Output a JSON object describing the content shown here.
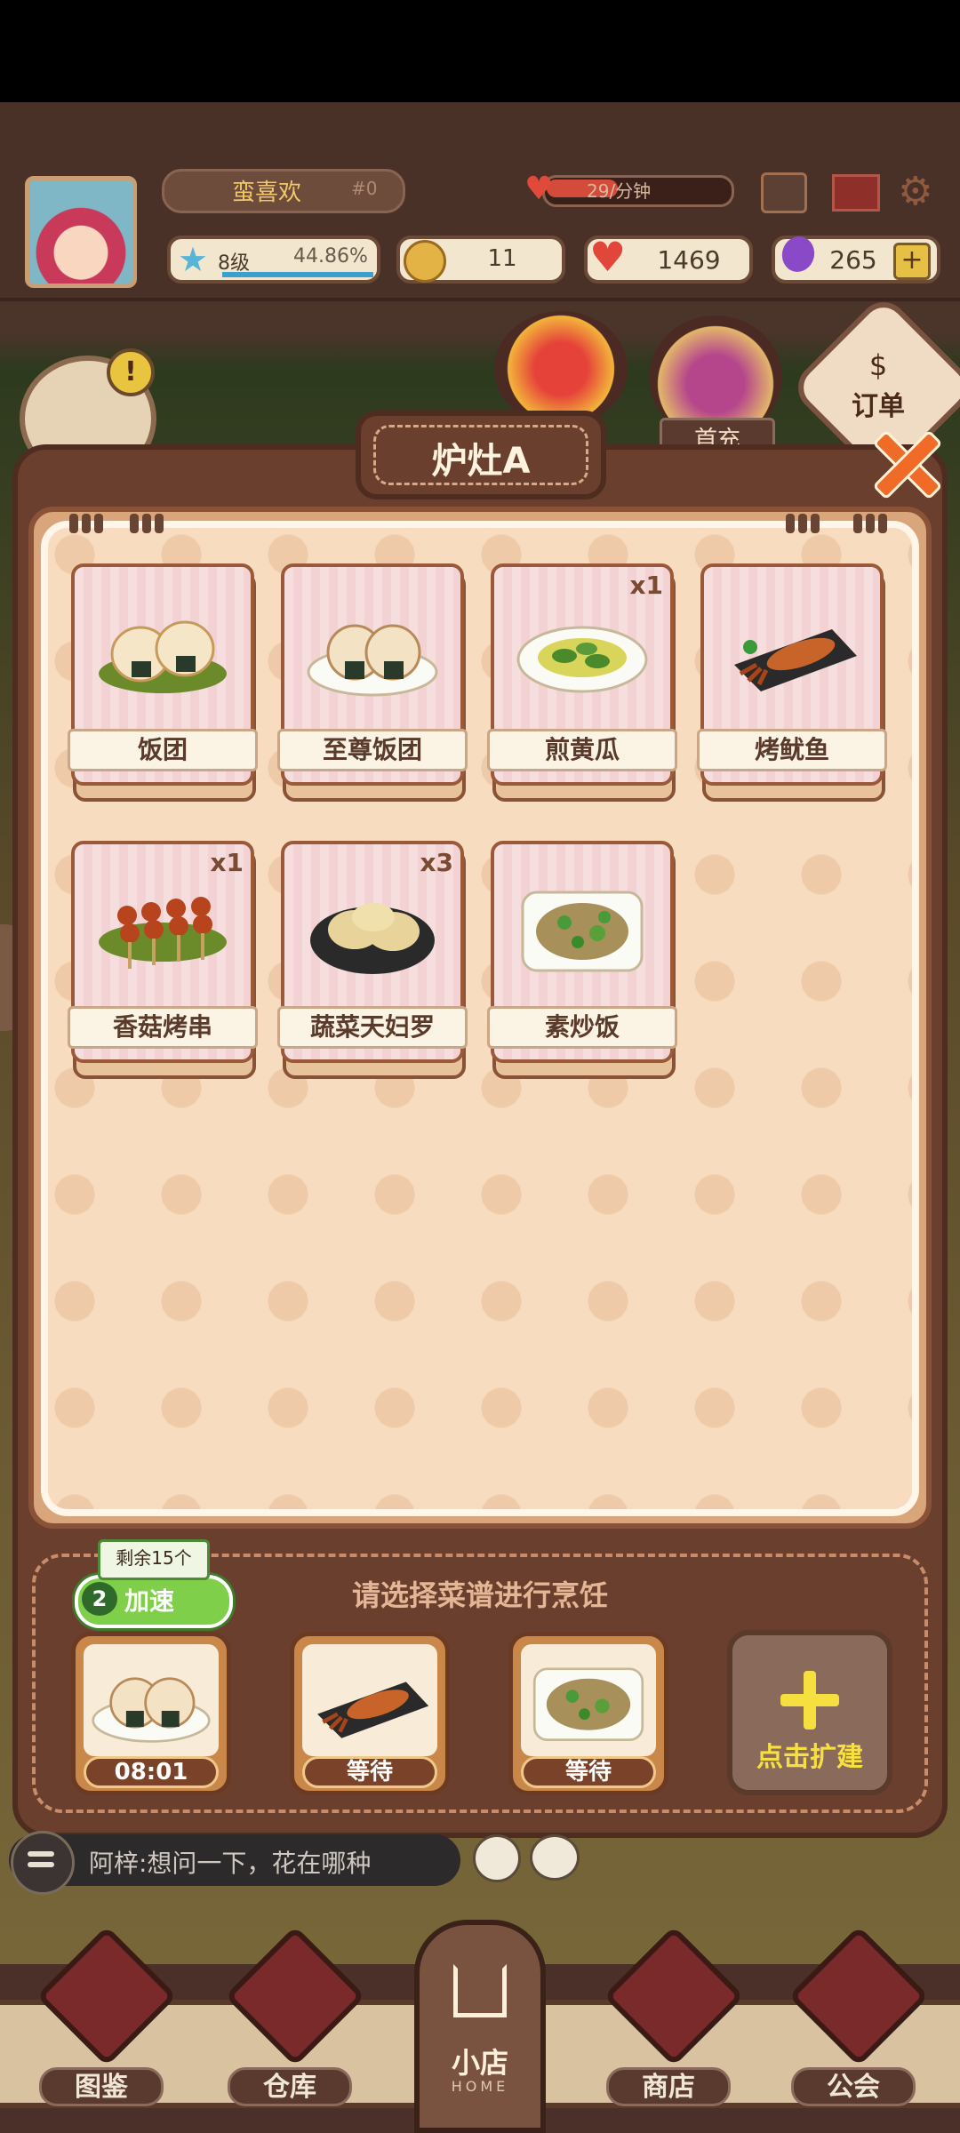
{
  "hud": {
    "player_name": "蛮喜欢",
    "player_id": "#0",
    "stamina_rate": "29/分钟",
    "level": "8级",
    "level_progress": "44.86%",
    "coins": "11",
    "hearts": "1469",
    "gems": "265",
    "gem_plus": "+"
  },
  "side_icons": {
    "alert": "!",
    "first_charge": "首充",
    "order": "订单",
    "order_symbol": "$"
  },
  "modal": {
    "title": "炉灶A",
    "recipes": [
      {
        "name": "饭团",
        "qty": ""
      },
      {
        "name": "至尊饭团",
        "qty": ""
      },
      {
        "name": "煎黄瓜",
        "qty": "x1"
      },
      {
        "name": "烤鱿鱼",
        "qty": ""
      },
      {
        "name": "香菇烤串",
        "qty": "x1"
      },
      {
        "name": "蔬菜天妇罗",
        "qty": "x3"
      },
      {
        "name": "素炒饭",
        "qty": ""
      }
    ]
  },
  "queue": {
    "hint": "请选择菜谱进行烹饪",
    "remaining": "剩余15个",
    "speedup_count": "2",
    "speedup_label": "加速",
    "slots": [
      {
        "dish": "至尊饭团",
        "status": "08:01"
      },
      {
        "dish": "烤鱿鱼",
        "status": "等待"
      },
      {
        "dish": "素炒饭",
        "status": "等待"
      }
    ],
    "expand_label": "点击扩建"
  },
  "chat": {
    "message": "阿梓:想问一下，花在哪种"
  },
  "nav": {
    "catalog": "图鉴",
    "warehouse": "仓库",
    "home": "小店",
    "home_sub": "HOME",
    "shop": "商店",
    "guild": "公会"
  },
  "colors": {
    "modal_frame": "#6b3f2d",
    "panel_bg": "#f8dcc0",
    "accent_orange": "#f06a28",
    "speedup_green": "#7fcf4a",
    "expand_yellow": "#f6e040"
  }
}
